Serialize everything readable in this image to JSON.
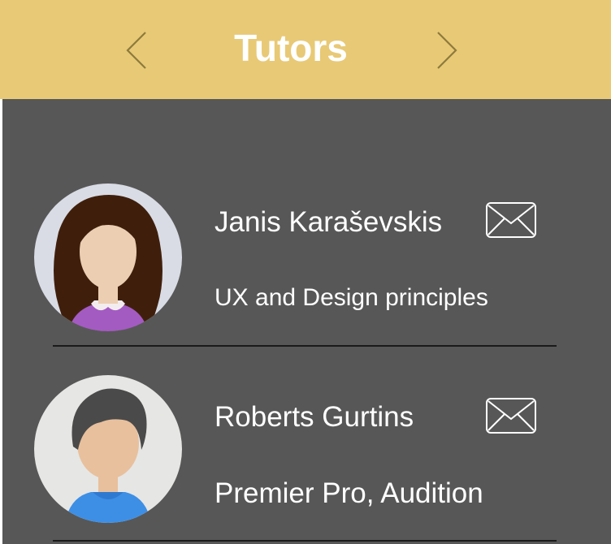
{
  "header": {
    "title": "Tutors",
    "prev_icon": "chevron-left-icon",
    "next_icon": "chevron-right-icon",
    "background_color": "#e8c976"
  },
  "tutors": [
    {
      "name": "Janis Karaševskis",
      "subject": "UX and Design principles",
      "avatar": "female-avatar",
      "mail_icon": "envelope-icon"
    },
    {
      "name": "Roberts Gurtins",
      "subject": "Premier Pro, Audition",
      "avatar": "male-avatar",
      "mail_icon": "envelope-icon"
    }
  ],
  "colors": {
    "background": "#575757",
    "text": "#ffffff",
    "divider": "#1a1a1a"
  }
}
